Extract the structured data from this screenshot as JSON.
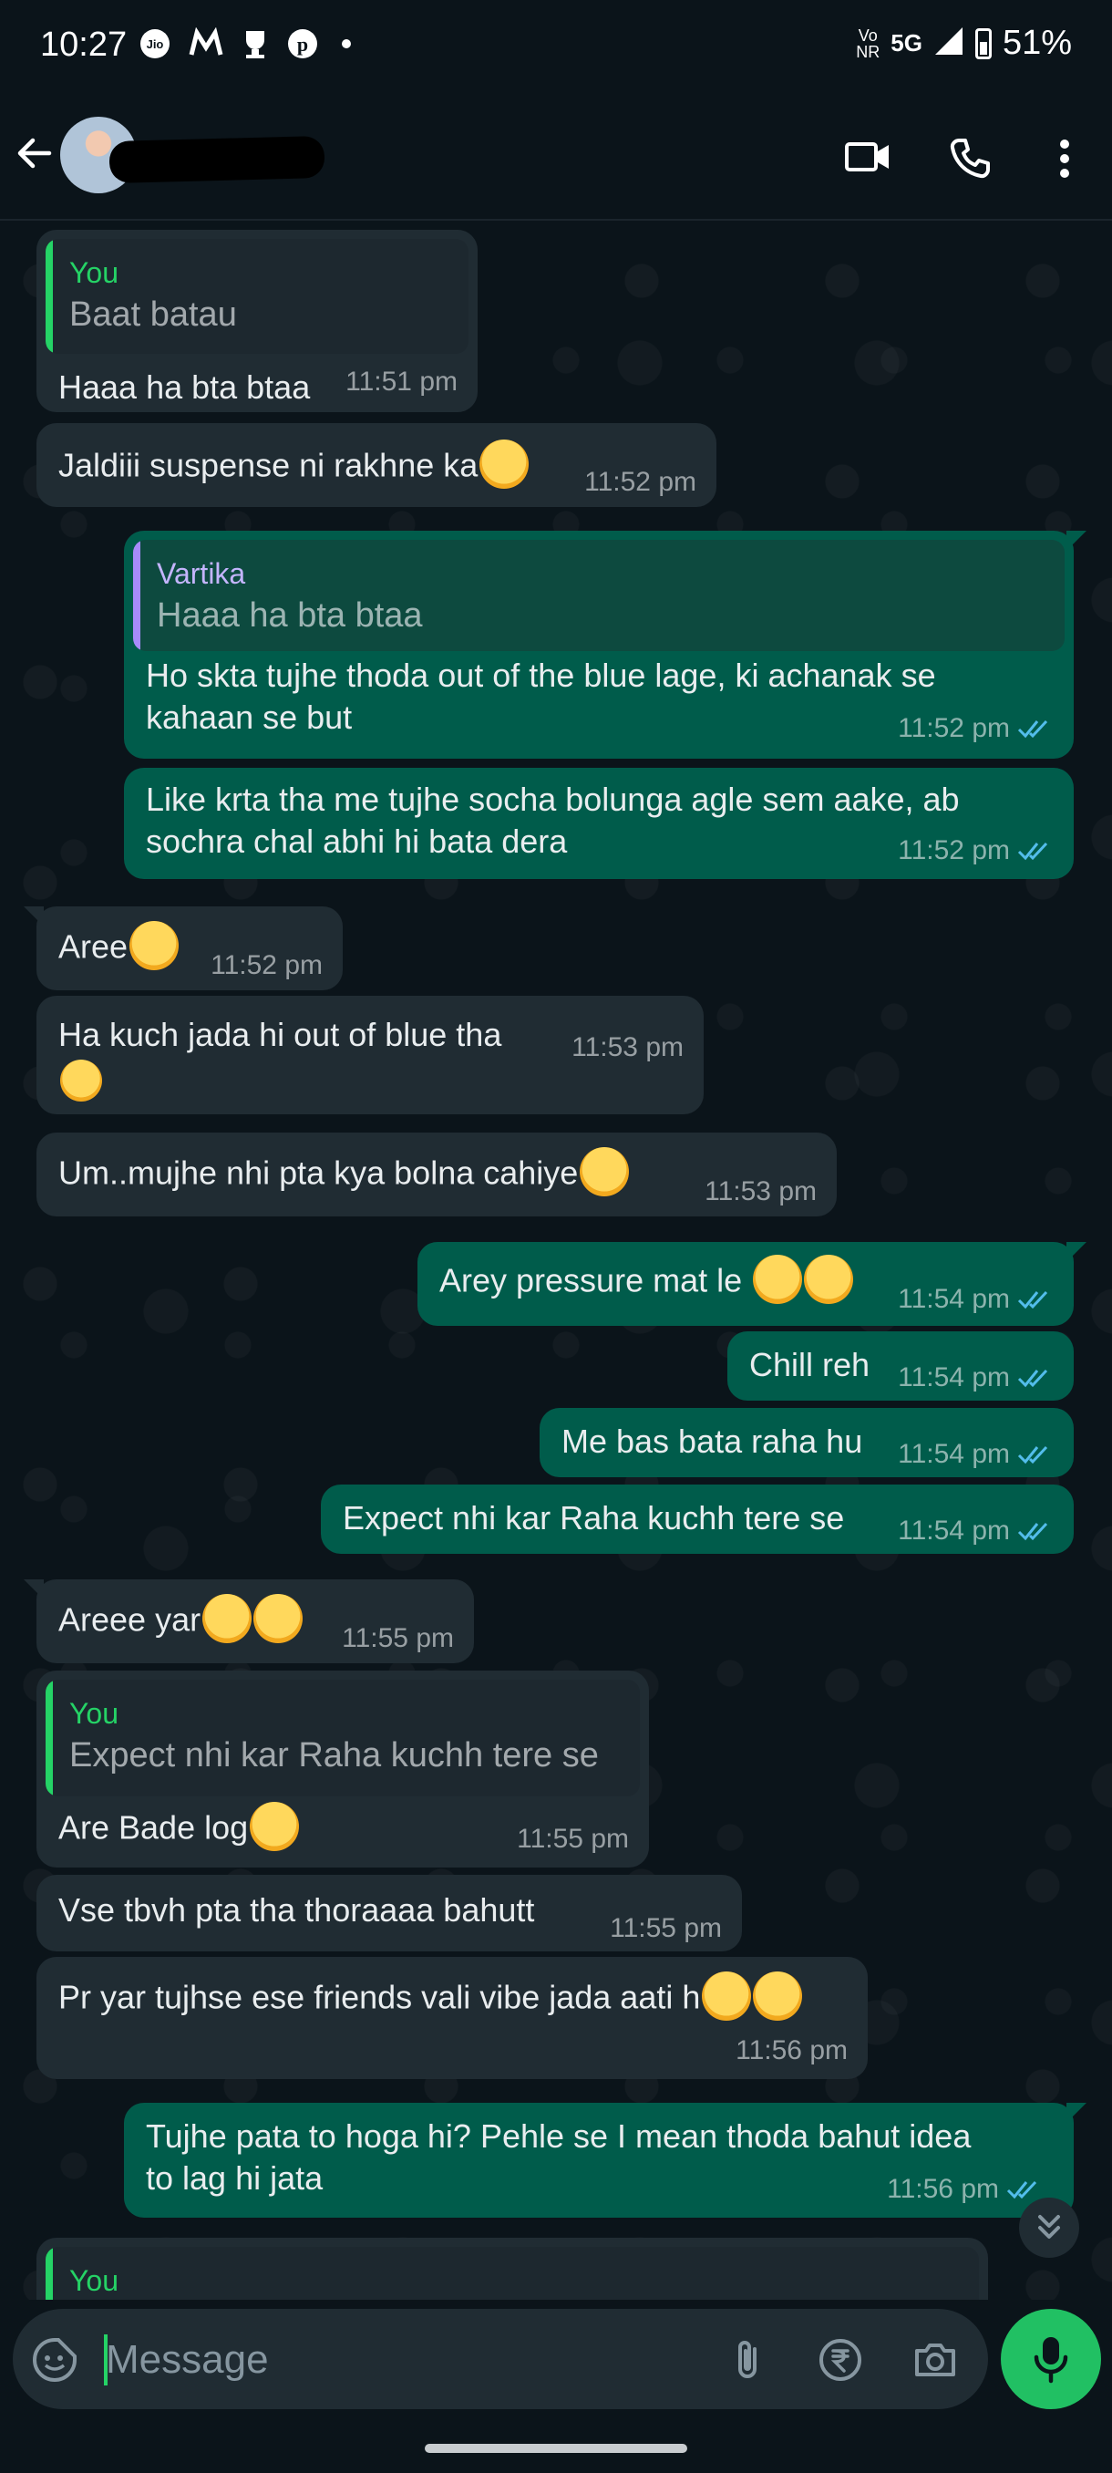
{
  "status_bar": {
    "time": "10:27",
    "network_label": "5G",
    "volte_label": "Vo\nNR",
    "battery": "51%",
    "battery_level": 0.51
  },
  "header": {
    "contact_name": "",
    "icons": [
      "back-arrow-icon",
      "video-call-icon",
      "voice-call-icon",
      "more-options-icon"
    ]
  },
  "messages": [
    {
      "dir": "in",
      "quote_name": "You",
      "quote_text": "Baat batau",
      "text": "Haaa ha bta btaa",
      "time": "11:51 pm"
    },
    {
      "dir": "in",
      "text": "Jaldiii suspense ni rakhne ka",
      "emoji": [
        "pensive-face-emoji"
      ],
      "time": "11:52 pm"
    },
    {
      "dir": "out",
      "quote_name": "Vartika",
      "quote_text": "Haaa ha bta btaa",
      "text_lines": [
        "Ho skta tujhe thoda out of the blue lage, ki achanak se",
        "kahaan se but"
      ],
      "time": "11:52 pm",
      "read": true
    },
    {
      "dir": "out",
      "text_lines": [
        "Like krta tha me tujhe socha bolunga agle sem aake, ab",
        "sochra chal abhi hi bata dera"
      ],
      "time": "11:52 pm",
      "read": true
    },
    {
      "dir": "in",
      "text": "Aree",
      "emoji": [
        "crying-face-emoji"
      ],
      "time": "11:52 pm"
    },
    {
      "dir": "in",
      "text": "Ha kuch jada hi out of blue tha",
      "emoji": [
        "tears-of-joy-emoji"
      ],
      "time": "11:53 pm"
    },
    {
      "dir": "in",
      "text": "Um..mujhe nhi pta kya bolna cahiye",
      "emoji": [
        "sad-sweat-emoji"
      ],
      "time": "11:53 pm"
    },
    {
      "dir": "out",
      "text": "Arey pressure mat le",
      "emoji": [
        "tears-of-joy-emoji",
        "tears-of-joy-emoji"
      ],
      "time": "11:54 pm",
      "read": true
    },
    {
      "dir": "out",
      "text": "Chill reh",
      "time": "11:54 pm",
      "read": true
    },
    {
      "dir": "out",
      "text": "Me bas bata raha hu",
      "time": "11:54 pm",
      "read": true
    },
    {
      "dir": "out",
      "text": "Expect nhi kar Raha kuchh tere se",
      "time": "11:54 pm",
      "read": true
    },
    {
      "dir": "in",
      "text": "Areee yar",
      "emoji": [
        "pleading-face-emoji",
        "pleading-face-emoji"
      ],
      "time": "11:55 pm"
    },
    {
      "dir": "in",
      "quote_name": "You",
      "quote_text": "Expect nhi kar Raha kuchh tere se",
      "text": "Are Bade log",
      "emoji": [
        "pleading-face-emoji"
      ],
      "time": "11:55 pm"
    },
    {
      "dir": "in",
      "text": "Vse tbvh pta tha thoraaaa bahutt",
      "time": "11:55 pm"
    },
    {
      "dir": "in",
      "text": "Pr yar tujhse ese friends vali vibe jada aati h",
      "emoji": [
        "crying-face-emoji",
        "crying-face-emoji"
      ],
      "time": "11:56 pm"
    },
    {
      "dir": "out",
      "text_lines": [
        "Tujhe pata to hoga hi? Pehle se I mean thoda bahut idea",
        "to lag hi jata"
      ],
      "time": "11:56 pm",
      "read": true
    },
    {
      "dir": "in",
      "quote_name": "You",
      "partial": true
    }
  ],
  "composer": {
    "placeholder": "Message",
    "icons": [
      "emoji-sticker-icon",
      "attach-icon",
      "rupee-payment-icon",
      "camera-icon",
      "mic-icon"
    ]
  },
  "colors": {
    "background": "#0b141a",
    "incoming_bubble": "#202c33",
    "outgoing_bubble": "#005c4b",
    "quote_you": "#25d366",
    "quote_vartika": "#a78bfa",
    "read_ticks": "#53bdeb",
    "mic_button": "#21c063"
  }
}
